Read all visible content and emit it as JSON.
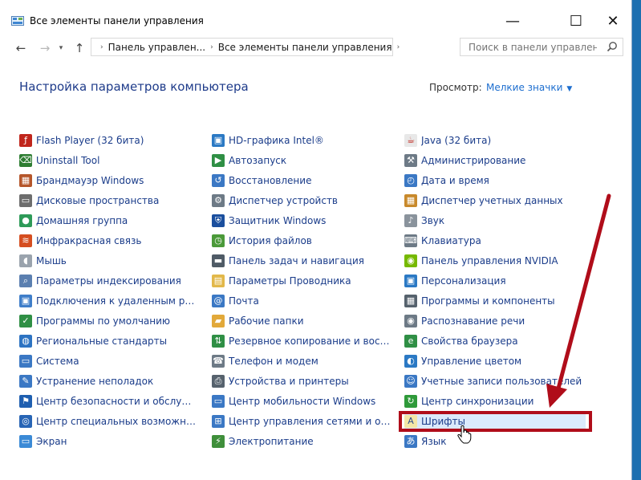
{
  "window": {
    "title": "Все элементы панели управления",
    "controls": {
      "minimize": "—",
      "maximize": "☐",
      "close": "✕"
    }
  },
  "nav": {
    "back": "←",
    "forward": "→",
    "recent": "▾",
    "up": "↑",
    "breadcrumb": [
      "Панель управлен...",
      "Все элементы панели управления"
    ],
    "breadcrumb_sep": "›",
    "address_dropdown": "⌄",
    "search_placeholder": "Поиск в панели управления"
  },
  "header": {
    "title": "Настройка параметров компьютера",
    "view_by_label": "Просмотр:",
    "view_by_value": "Мелкие значки",
    "view_by_caret": "▼"
  },
  "colors": {
    "link": "#1a3c8a",
    "heading": "#1e3b8a",
    "annotation": "#b00d1a",
    "highlight": "#dbeafc"
  },
  "columns": [
    [
      {
        "label": "Flash Player (32 бита)",
        "icon": "flash-icon"
      },
      {
        "label": "Uninstall Tool",
        "icon": "uninstall-icon"
      },
      {
        "label": "Брандмауэр Windows",
        "icon": "firewall-icon"
      },
      {
        "label": "Дисковые пространства",
        "icon": "storage-icon"
      },
      {
        "label": "Домашняя группа",
        "icon": "homegroup-icon"
      },
      {
        "label": "Инфракрасная связь",
        "icon": "infrared-icon"
      },
      {
        "label": "Мышь",
        "icon": "mouse-icon"
      },
      {
        "label": "Параметры индексирования",
        "icon": "indexing-icon"
      },
      {
        "label": "Подключения к удаленным рабоч...",
        "icon": "remote-icon"
      },
      {
        "label": "Программы по умолчанию",
        "icon": "default-programs-icon"
      },
      {
        "label": "Региональные стандарты",
        "icon": "region-icon"
      },
      {
        "label": "Система",
        "icon": "system-icon"
      },
      {
        "label": "Устранение неполадок",
        "icon": "troubleshoot-icon"
      },
      {
        "label": "Центр безопасности и обслуживан...",
        "icon": "flag-icon"
      },
      {
        "label": "Центр специальных возможностей",
        "icon": "accessibility-icon"
      },
      {
        "label": "Экран",
        "icon": "display-icon"
      }
    ],
    [
      {
        "label": "HD-графика Intel®",
        "icon": "intel-graphics-icon"
      },
      {
        "label": "Автозапуск",
        "icon": "autoplay-icon"
      },
      {
        "label": "Восстановление",
        "icon": "recovery-icon"
      },
      {
        "label": "Диспетчер устройств",
        "icon": "device-manager-icon"
      },
      {
        "label": "Защитник Windows",
        "icon": "defender-icon"
      },
      {
        "label": "История файлов",
        "icon": "file-history-icon"
      },
      {
        "label": "Панель задач и навигация",
        "icon": "taskbar-icon"
      },
      {
        "label": "Параметры Проводника",
        "icon": "explorer-options-icon"
      },
      {
        "label": "Почта",
        "icon": "mail-icon"
      },
      {
        "label": "Рабочие папки",
        "icon": "work-folders-icon"
      },
      {
        "label": "Резервное копирование и восстан...",
        "icon": "backup-icon"
      },
      {
        "label": "Телефон и модем",
        "icon": "phone-icon"
      },
      {
        "label": "Устройства и принтеры",
        "icon": "printer-icon"
      },
      {
        "label": "Центр мобильности Windows",
        "icon": "mobility-icon"
      },
      {
        "label": "Центр управления сетями и общи...",
        "icon": "network-icon"
      },
      {
        "label": "Электропитание",
        "icon": "power-icon"
      }
    ],
    [
      {
        "label": "Java (32 бита)",
        "icon": "java-icon"
      },
      {
        "label": "Администрирование",
        "icon": "admin-tools-icon"
      },
      {
        "label": "Дата и время",
        "icon": "datetime-icon"
      },
      {
        "label": "Диспетчер учетных данных",
        "icon": "credential-icon"
      },
      {
        "label": "Звук",
        "icon": "sound-icon"
      },
      {
        "label": "Клавиатура",
        "icon": "keyboard-icon"
      },
      {
        "label": "Панель управления NVIDIA",
        "icon": "nvidia-icon"
      },
      {
        "label": "Персонализация",
        "icon": "personalization-icon"
      },
      {
        "label": "Программы и компоненты",
        "icon": "programs-icon"
      },
      {
        "label": "Распознавание речи",
        "icon": "speech-icon"
      },
      {
        "label": "Свойства браузера",
        "icon": "internet-options-icon"
      },
      {
        "label": "Управление цветом",
        "icon": "color-management-icon"
      },
      {
        "label": "Учетные записи пользователей",
        "icon": "users-icon"
      },
      {
        "label": "Центр синхронизации",
        "icon": "sync-icon"
      },
      {
        "label": "Шрифты",
        "icon": "fonts-icon",
        "highlighted": true
      },
      {
        "label": "Язык",
        "icon": "language-icon"
      }
    ]
  ]
}
